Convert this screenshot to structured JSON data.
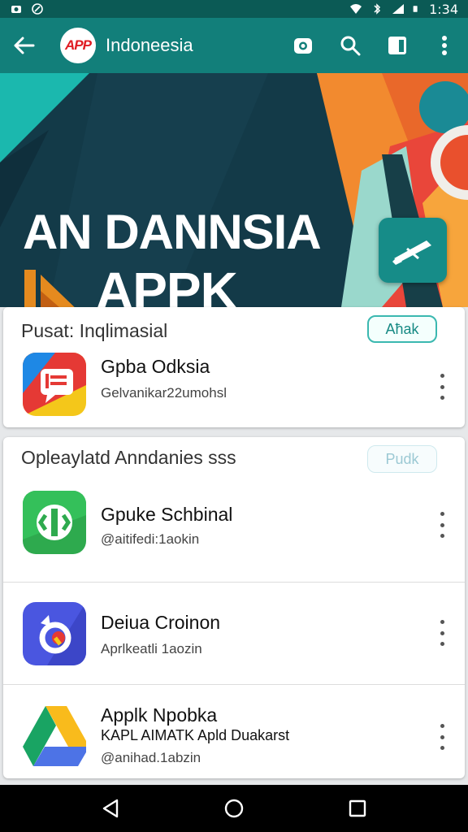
{
  "status_bar": {
    "time": "1:34"
  },
  "toolbar": {
    "logo_text": "APP",
    "title": "Indoneesia"
  },
  "banner": {
    "title": "AN DANNSIA",
    "subtitle": "APPK"
  },
  "section1": {
    "heading": "Pusat: Inqlimasial",
    "chip": "Aħak",
    "apps": [
      {
        "name": "Gpba Odksia",
        "sub": "Gelvanikar22umohsl"
      }
    ]
  },
  "section2": {
    "heading": "Opleaylatd Anndanies sss",
    "chip": "Pudk",
    "apps": [
      {
        "name": "Gpuke Schbinal",
        "sub": "@aitifedi:1aokin"
      },
      {
        "name": "Deiua Croinon",
        "sub": "Aprlkeatli 1aozin"
      },
      {
        "name": "Applk Npobka",
        "sub": "KAPL AIMATK Apld Duakarst",
        "sub2": "@anihad.1abzin"
      }
    ]
  },
  "colors": {
    "status_bar": "#0b5a55",
    "toolbar": "#127f7a",
    "accent": "#3bb8b0",
    "nav_bar": "#000000"
  },
  "icons": [
    "back-arrow-icon",
    "camera-icon",
    "search-icon",
    "bookmark-icon",
    "more-vert-icon",
    "nav-back-icon",
    "nav-home-icon",
    "nav-recents-icon"
  ]
}
